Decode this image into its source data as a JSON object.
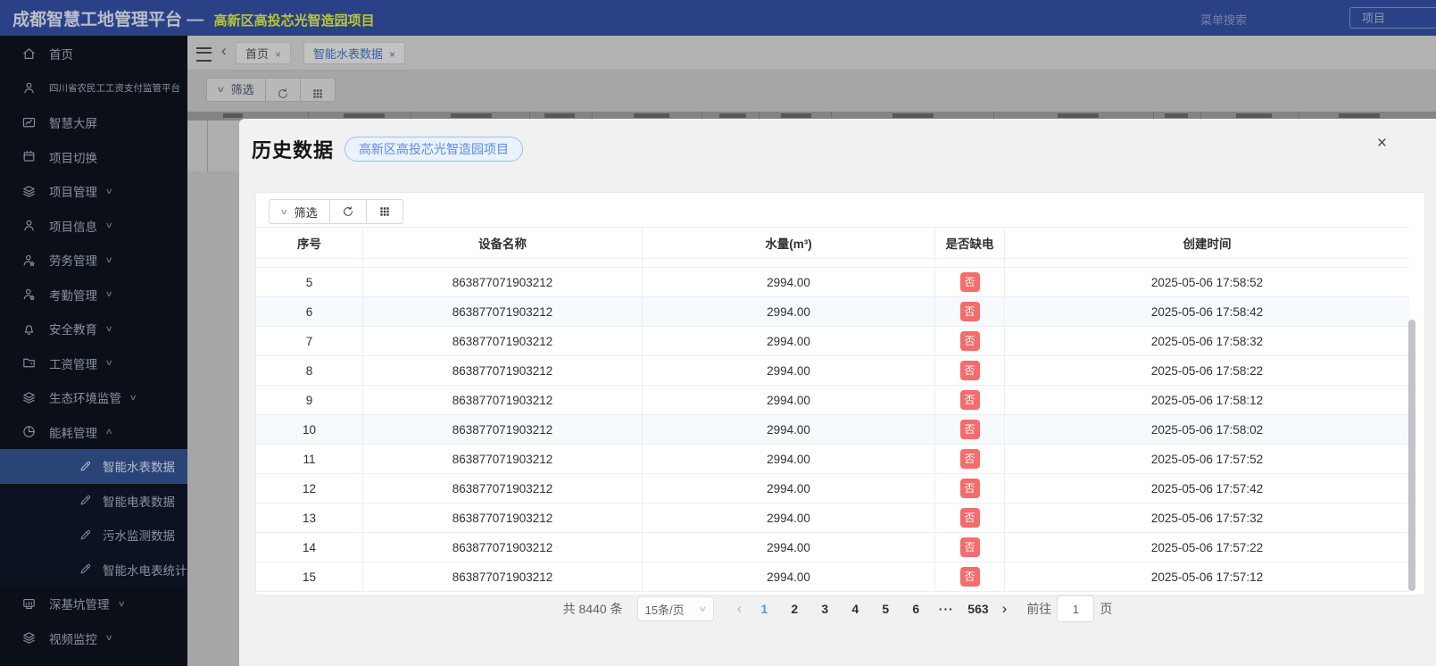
{
  "header": {
    "app_title": "成都智慧工地管理平台",
    "title_separator": "—",
    "project_name": "高新区高投芯光智造园项目",
    "menu_search_label": "菜单搜索",
    "project_switch_button": "项目"
  },
  "sidebar": {
    "items": [
      {
        "label": "首页",
        "icon": "home"
      },
      {
        "label": "四川省农民工工资支付监管平台",
        "icon": "user"
      },
      {
        "label": "智慧大屏",
        "icon": "chart"
      },
      {
        "label": "项目切换",
        "icon": "calendar"
      },
      {
        "label": "项目管理",
        "icon": "layers",
        "arrow": "down"
      },
      {
        "label": "项目信息",
        "icon": "user",
        "arrow": "down"
      },
      {
        "label": "劳务管理",
        "icon": "user-badge",
        "arrow": "down"
      },
      {
        "label": "考勤管理",
        "icon": "user-badge",
        "arrow": "down"
      },
      {
        "label": "安全教育",
        "icon": "bell",
        "arrow": "down"
      },
      {
        "label": "工资管理",
        "icon": "folder",
        "arrow": "down"
      },
      {
        "label": "生态环境监管",
        "icon": "layers",
        "arrow": "down"
      },
      {
        "label": "能耗管理",
        "icon": "pie",
        "arrow": "up"
      },
      {
        "label": "智能水表数据",
        "icon": "pen",
        "child": true,
        "active": true
      },
      {
        "label": "智能电表数据",
        "icon": "pen",
        "child": true
      },
      {
        "label": "污水监测数据",
        "icon": "pen",
        "child": true
      },
      {
        "label": "智能水电表统计",
        "icon": "pen",
        "child": true
      },
      {
        "label": "深基坑管理",
        "icon": "monitor",
        "arrow": "down"
      },
      {
        "label": "视频监控",
        "icon": "layers",
        "arrow": "down"
      }
    ]
  },
  "tabbar": {
    "tabs": [
      {
        "label": "首页",
        "active": false
      },
      {
        "label": "智能水表数据",
        "active": true
      }
    ],
    "close_glyph": "×"
  },
  "background_toolbar": {
    "filter_chevron": "∨",
    "filter_label": "筛选"
  },
  "modal": {
    "title": "历史数据",
    "project_badge": "高新区高投芯光智造园项目",
    "close_glyph": "×",
    "toolbar": {
      "filter_chevron": "∨",
      "filter_label": "筛选"
    },
    "table": {
      "columns": [
        "序号",
        "设备名称",
        "水量(m³)",
        "是否缺电",
        "创建时间"
      ],
      "rows": [
        {
          "index": "5",
          "device": "863877071903212",
          "water": "2994.00",
          "power_lack": "否",
          "created": "2025-05-06 17:58:52",
          "highlighted": false
        },
        {
          "index": "6",
          "device": "863877071903212",
          "water": "2994.00",
          "power_lack": "否",
          "created": "2025-05-06 17:58:42",
          "highlighted": true
        },
        {
          "index": "7",
          "device": "863877071903212",
          "water": "2994.00",
          "power_lack": "否",
          "created": "2025-05-06 17:58:32",
          "highlighted": false
        },
        {
          "index": "8",
          "device": "863877071903212",
          "water": "2994.00",
          "power_lack": "否",
          "created": "2025-05-06 17:58:22",
          "highlighted": false
        },
        {
          "index": "9",
          "device": "863877071903212",
          "water": "2994.00",
          "power_lack": "否",
          "created": "2025-05-06 17:58:12",
          "highlighted": false
        },
        {
          "index": "10",
          "device": "863877071903212",
          "water": "2994.00",
          "power_lack": "否",
          "created": "2025-05-06 17:58:02",
          "highlighted": true
        },
        {
          "index": "11",
          "device": "863877071903212",
          "water": "2994.00",
          "power_lack": "否",
          "created": "2025-05-06 17:57:52",
          "highlighted": false
        },
        {
          "index": "12",
          "device": "863877071903212",
          "water": "2994.00",
          "power_lack": "否",
          "created": "2025-05-06 17:57:42",
          "highlighted": false
        },
        {
          "index": "13",
          "device": "863877071903212",
          "water": "2994.00",
          "power_lack": "否",
          "created": "2025-05-06 17:57:32",
          "highlighted": false
        },
        {
          "index": "14",
          "device": "863877071903212",
          "water": "2994.00",
          "power_lack": "否",
          "created": "2025-05-06 17:57:22",
          "highlighted": false
        },
        {
          "index": "15",
          "device": "863877071903212",
          "water": "2994.00",
          "power_lack": "否",
          "created": "2025-05-06 17:57:12",
          "highlighted": false
        }
      ]
    },
    "pagination": {
      "total_label": "共 8440 条",
      "page_size_label": "15条/页",
      "prev_glyph": "‹",
      "next_glyph": "›",
      "pages": [
        {
          "label": "1",
          "active": true
        },
        {
          "label": "2"
        },
        {
          "label": "3"
        },
        {
          "label": "4"
        },
        {
          "label": "5"
        },
        {
          "label": "6"
        },
        {
          "label": "···",
          "more": true
        },
        {
          "label": "563"
        }
      ],
      "goto_label": "前往",
      "goto_value": "1",
      "goto_suffix": "页"
    }
  },
  "colors": {
    "accent_blue": "#409eff",
    "active_tab_blue": "#3a5fa9",
    "badge_red": "#f46c6c",
    "header_bg": "#2a4187",
    "project_name_yellow": "#b9c637",
    "sidebar_bg": "#0a0f18",
    "sidebar_active_bg": "#2b4478",
    "pill_text": "#5a8de6",
    "pill_bg": "#e9f2fd",
    "pill_border": "#a0c0ee"
  }
}
